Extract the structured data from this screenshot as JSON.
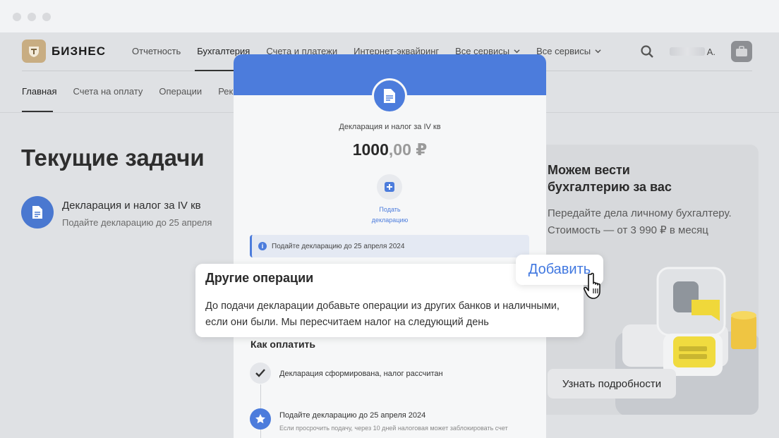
{
  "logo": {
    "text": "БИЗНЕС"
  },
  "topnav": [
    {
      "label": "Отчетность"
    },
    {
      "label": "Бухгалтерия"
    },
    {
      "label": "Счета и платежи"
    },
    {
      "label": "Интернет-эквайринг"
    },
    {
      "label": "Все сервисы"
    },
    {
      "label": "Все сервисы"
    }
  ],
  "user": {
    "initial": "А."
  },
  "subnav": [
    {
      "label": "Главная"
    },
    {
      "label": "Счета на оплату"
    },
    {
      "label": "Операции"
    },
    {
      "label": "Рекви"
    }
  ],
  "main": {
    "heading": "Текущие задачи",
    "task": {
      "title": "Декларация и налог за IV кв",
      "subtitle": "Подайте декларацию до 25 апреля"
    }
  },
  "promo": {
    "title_line1": "Можем вести",
    "title_line2": "бухгалтерию за вас",
    "text_line1": "Передайте дела личному бухгалтеру.",
    "text_line2": "Стоимость — от 3 990 ₽ в месяц",
    "button": "Узнать подробности"
  },
  "modal": {
    "title": "Декларация и налог за IV кв",
    "amount_main": "1000",
    "amount_cents": ",00 ₽",
    "add_label_line1": "Подать",
    "add_label_line2": "декларацию",
    "banner": "Подайте декларацию до 25 апреля 2024",
    "how_to_pay": "Как оплатить",
    "step1": "Декларация сформирована, налог рассчитан",
    "step2": "Подайте декларацию до 25 апреля 2024",
    "step2_sub": "Если просрочить подачу, через 10 дней налоговая может заблокировать счет"
  },
  "tooltip": {
    "title": "Другие операции",
    "text": "До подачи декларации добавьте операции из других банков и наличными, если они были. Мы пересчитаем налог на следующий день",
    "button": "Добавить"
  },
  "colors": {
    "accent": "#4c7cdc",
    "logo": "#c8ad82"
  }
}
